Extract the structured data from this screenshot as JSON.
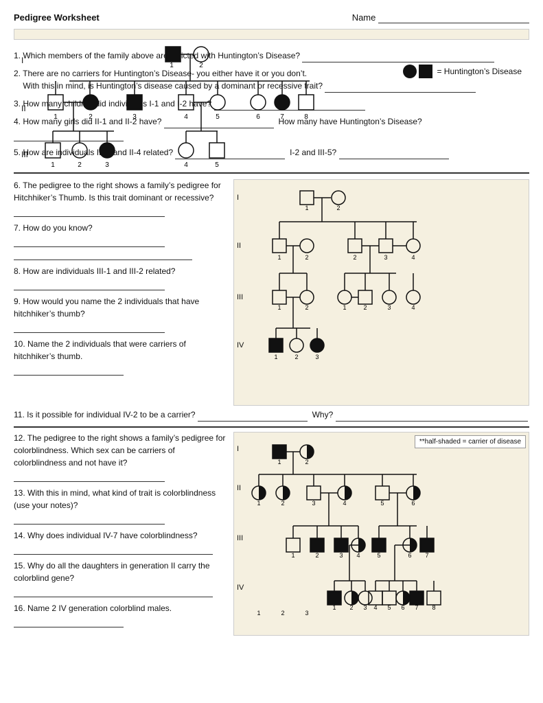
{
  "header": {
    "title": "Pedigree Worksheet",
    "name_label": "Name"
  },
  "questions_part1": [
    {
      "id": "q1",
      "text": "1. Which members of the family above are afflicted with Huntington’s Disease?"
    },
    {
      "id": "q2a",
      "text": "2. There are no carriers for Huntington’s Disease- you either have it or you don’t."
    },
    {
      "id": "q2b",
      "text": "With this in mind, is Huntington’s disease caused by a dominant or recessive trait?"
    },
    {
      "id": "q3",
      "text": "3. How many children did individuals I-1 and I-2 have?"
    },
    {
      "id": "q4a",
      "text": "4. How many girls did II-1 and II-2 have?"
    },
    {
      "id": "q4b",
      "text": "How many have Huntington’s Disease?"
    },
    {
      "id": "q5a",
      "text": "5. How are individuals III-2 and II-4 related?"
    },
    {
      "id": "q5b",
      "text": "I-2 and III-5?"
    }
  ],
  "questions_part2": [
    {
      "id": "q6",
      "text": "6. The pedigree to the right shows a family’s pedigree for Hitchhiker’s Thumb. Is this trait dominant or recessive?"
    },
    {
      "id": "q7",
      "text": "7. How do you know?"
    },
    {
      "id": "q8",
      "text": "8. How are individuals III-1 and III-2 related?"
    },
    {
      "id": "q9",
      "text": "9. How would you name the 2 individuals that have hitchhiker’s thumb?"
    },
    {
      "id": "q10",
      "text": "10. Name the 2 individuals that were carriers of hitchhiker’s thumb."
    },
    {
      "id": "q11",
      "text": "11. Is it possible for individual IV-2 to be a carrier?"
    },
    {
      "id": "q11b",
      "text": "Why?"
    }
  ],
  "questions_part3": [
    {
      "id": "q12",
      "text": "12. The pedigree to the right shows a family’s pedigree for colorblindness. Which sex can be carriers of colorblindness and not have it?"
    },
    {
      "id": "q13",
      "text": "13. With this in mind, what kind of trait is colorblindness (use your notes)?"
    },
    {
      "id": "q14",
      "text": "14. Why does individual IV-7 have colorblindness?"
    },
    {
      "id": "q15",
      "text": "15. Why do all the daughters in generation II carry the colorblind gene?"
    },
    {
      "id": "q16",
      "text": "16. Name 2 IV generation colorblind males."
    }
  ],
  "legend": {
    "filled_label": "= Huntington’s Disease"
  },
  "note_colorblind": "**half-shaded = carrier of disease"
}
